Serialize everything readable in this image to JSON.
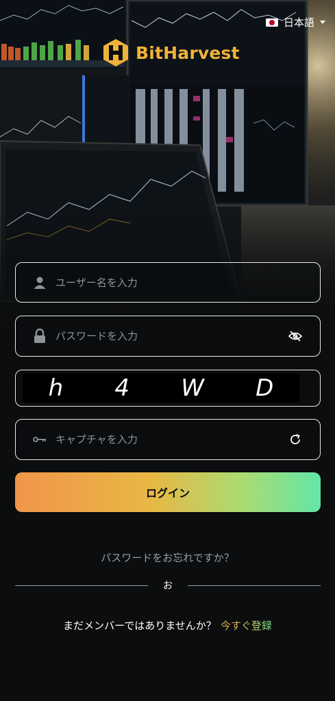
{
  "header": {
    "language": "日本語",
    "brand_name": "BitHarvest"
  },
  "form": {
    "username_placeholder": "ユーザー名を入力",
    "password_placeholder": "パスワードを入力",
    "captcha_chars": [
      "h",
      "4",
      "W",
      "D"
    ],
    "captcha_placeholder": "キャプチャを入力",
    "login_label": "ログイン"
  },
  "footer": {
    "forgot_password": "パスワードをお忘れですか？",
    "divider_text": "お",
    "signup_prompt": "まだメンバーではありませんか？",
    "signup_link": "今すぐ登録"
  },
  "colors": {
    "accent_gold": "#f0b23a",
    "gradient_start": "#f0954a",
    "gradient_end": "#63e6a6",
    "background": "#0b0d0e"
  },
  "icons": {
    "username": "user-icon",
    "password": "lock-icon",
    "password_toggle": "eye-off-icon",
    "captcha": "key-icon",
    "refresh": "refresh-icon",
    "flag": "japan-flag-icon",
    "dropdown": "chevron-down-icon",
    "logo": "bitharvest-logo-icon"
  }
}
